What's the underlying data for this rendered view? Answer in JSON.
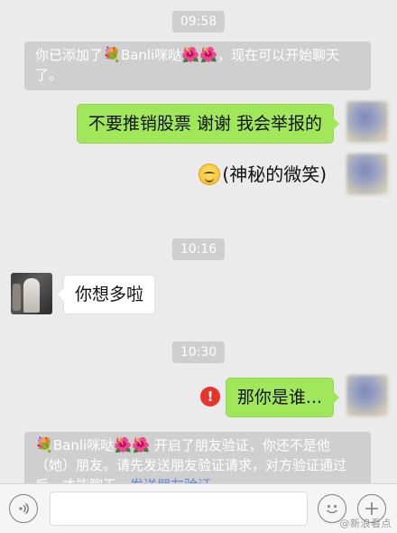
{
  "timestamps": [
    "09:58",
    "10:16",
    "10:30"
  ],
  "system_top": {
    "before": "你已添加了",
    "name": "Banli咪哒",
    "after": "，现在可以开始聊天了。"
  },
  "messages": {
    "msg1": "不要推销股票 谢谢   我会举报的",
    "msg2_text": "(神秘的微笑)",
    "msg3": "你想多啦",
    "msg4": "那你是谁..."
  },
  "error_glyph": "!",
  "system_bottom": {
    "name": "Banli咪哒",
    "text": "开启了朋友验证，你还不是他（她）朋友。请先发送朋友验证请求，对方验证通过后，才能聊天。",
    "link": "发送朋友验证"
  },
  "flower_emoji": "💐",
  "hibiscus_emoji": "🌺",
  "watermark": "@新浪看点"
}
